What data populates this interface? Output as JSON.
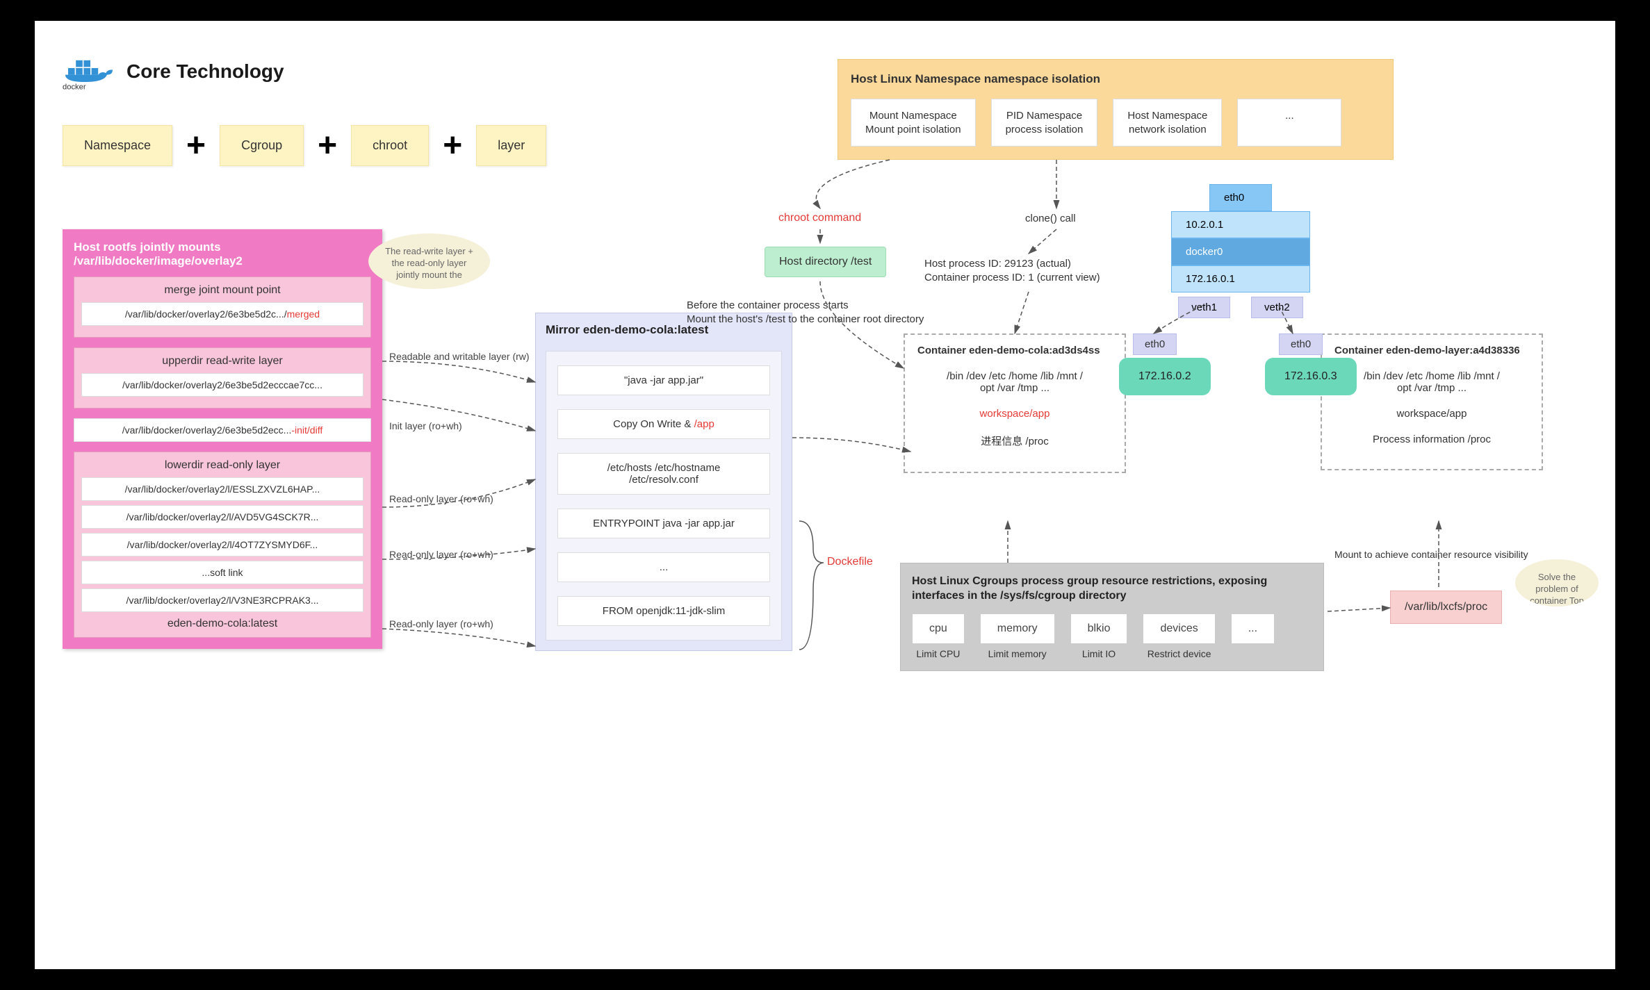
{
  "title": "Core Technology",
  "docker_label": "docker",
  "core_boxes": [
    "Namespace",
    "Cgroup",
    "chroot",
    "layer"
  ],
  "pink_panel": {
    "title": "Host rootfs jointly mounts /var/lib/docker/image/overlay2",
    "merge": {
      "title": "merge joint mount point",
      "path_prefix": "/var/lib/docker/overlay2/6e3be5d2c.../",
      "path_suffix": "merged"
    },
    "upper": {
      "title": "upperdir read-write layer",
      "path": "/var/lib/docker/overlay2/6e3be5d2ecccae7cc..."
    },
    "init": {
      "path_prefix": "/var/lib/docker/overlay2/6e3be5d2ecc...",
      "path_suffix": "-init/diff"
    },
    "lower": {
      "title": "lowerdir read-only layer",
      "paths": [
        "/var/lib/docker/overlay2/l/ESSLZXVZL6HAP...",
        "/var/lib/docker/overlay2/l/AVD5VG4SCK7R...",
        "/var/lib/docker/overlay2/l/4OT7ZYSMYD6F...",
        "...soft link",
        "/var/lib/docker/overlay2/l/V3NE3RCPRAK3..."
      ],
      "tag": "eden-demo-cola:latest"
    }
  },
  "layer_labels": {
    "rw": "Readable and writable layer (rw)",
    "init": "Init layer (ro+wh)",
    "ro1": "Read-only layer (ro+wh)",
    "ro2": "Read-only layer (ro+wh)",
    "ro3": "Read-only layer (ro+wh)"
  },
  "note_bubble_merge": "The read-write layer + the read-only layer jointly mount the",
  "mirror": {
    "title": "Mirror eden-demo-cola:latest",
    "rows_pre": "\"java -jar app.jar\"",
    "cow_prefix": "Copy On Write & ",
    "cow_suffix": "/app",
    "rows_mid": "/etc/hosts /etc/hostname\n/etc/resolv.conf",
    "rows_entry": "ENTRYPOINT java -jar app.jar",
    "rows_dots": "...",
    "rows_from": "FROM openjdk:11-jdk-slim"
  },
  "dockerfile_label": "Dockefile",
  "namespace_panel": {
    "title": "Host Linux Namespace namespace isolation",
    "boxes": [
      "Mount Namespace\nMount point isolation",
      "PID Namespace\nprocess isolation",
      "Host Namespace\nnetwork isolation",
      "..."
    ]
  },
  "chroot_cmd": "chroot command",
  "host_dir": "Host directory /test",
  "chroot_desc": "Before the container process starts\nMount the host's /test to the container root directory",
  "clone_call": "clone() call",
  "pid_info": "Host process ID: 29123 (actual)\nContainer process ID: 1 (current view)",
  "net": {
    "eth0": "eth0",
    "ip_host": "10.2.0.1",
    "docker0": "docker0",
    "ip_docker": "172.16.0.1",
    "veth1": "veth1",
    "veth2": "veth2"
  },
  "containers": {
    "a": {
      "title": "Container eden-demo-cola:ad3ds4ss",
      "eth": "eth0",
      "ip": "172.16.0.2",
      "dirs": "/bin /dev /etc /home /lib /mnt /\nopt /var /tmp ...",
      "workspace": "workspace/app",
      "proc": "进程信息 /proc"
    },
    "b": {
      "title": "Container eden-demo-layer:a4d38336",
      "eth": "eth0",
      "ip": "172.16.0.3",
      "dirs": "/bin /dev /etc /home /lib /mnt /\nopt /var /tmp ...",
      "workspace": "workspace/app",
      "proc": "Process information /proc"
    }
  },
  "cgroup": {
    "title": "Host Linux Cgroups process group resource restrictions, exposing interfaces in the /sys/fs/cgroup directory",
    "cols": [
      {
        "box": "cpu",
        "label": "Limit CPU"
      },
      {
        "box": "memory",
        "label": "Limit memory"
      },
      {
        "box": "blkio",
        "label": "Limit IO"
      },
      {
        "box": "devices",
        "label": "Restrict device"
      },
      {
        "box": "...",
        "label": ""
      }
    ]
  },
  "lxcfs": "/var/lib/lxcfs/proc",
  "mount_visibility": "Mount to achieve container resource visibility",
  "note_bubble_top": "Solve the problem of container Top",
  "colors": {
    "yellow": "#fef3c2",
    "pink": "#f17ac4",
    "pink_sub": "#f8c5da",
    "lavender": "#e3e5f8",
    "orange": "#fbd99a",
    "green": "#bdeed0",
    "teal": "#6bd8ba",
    "blue": "#87c7f5",
    "grey": "#ccc",
    "red_box": "#f8d0d0",
    "red_text": "#e53935"
  }
}
